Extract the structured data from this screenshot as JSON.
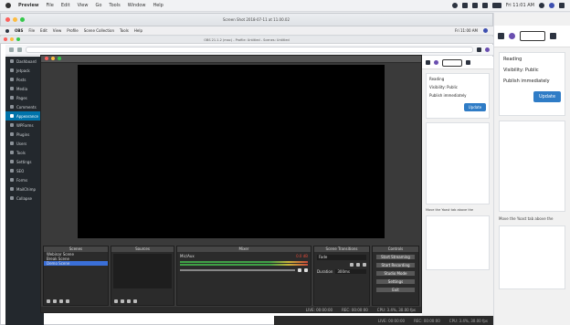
{
  "menubar": {
    "app_name": "Preview",
    "items": [
      "File",
      "Edit",
      "View",
      "Go",
      "Tools",
      "Window",
      "Help"
    ],
    "clock": "Fri 11:01 AM"
  },
  "preview_window": {
    "title": "Screen Shot 2018-07-11 at 11.00.02"
  },
  "inner_menubar": {
    "app_name": "OBS",
    "items": [
      "File",
      "Edit",
      "View",
      "Profile",
      "Scene Collection",
      "Tools",
      "Help"
    ],
    "clock": "Fri 11:00 AM"
  },
  "inner_title": {
    "text": "OBS 21.1.2 (mac) - Profile: Untitled - Scenes: Untitled"
  },
  "wp_sidebar": {
    "items": [
      "Dashboard",
      "Jetpack",
      "Posts",
      "Media",
      "Pages",
      "Comments",
      "Appearance",
      "WPForms",
      "Plugins",
      "Users",
      "Tools",
      "Settings",
      "SEO",
      "Forms",
      "MailChimp",
      "Collapse"
    ]
  },
  "right_panel": {
    "lines": [
      "Reading",
      "Visibility: Public",
      "Publish immediately",
      "Update"
    ],
    "update_label": "Update",
    "note": "Move the Yoast tab above the"
  },
  "obs": {
    "docks": {
      "scenes": "Scenes",
      "sources": "Sources",
      "mixer": "Mixer",
      "transitions": "Scene Transitions",
      "controls": "Controls"
    },
    "scenes": [
      "Webinar Scene",
      "Break Scene",
      "Demo Scene"
    ],
    "selected_scene_index": 2,
    "mixer_track": "Mic/Aux",
    "mixer_level_db": "0.0 dB",
    "transition_type": "Fade",
    "duration_label": "Duration",
    "duration_value": "300ms",
    "controls": [
      "Start Streaming",
      "Start Recording",
      "Studio Mode",
      "Settings",
      "Exit"
    ],
    "status": [
      "LIVE: 00:00:00",
      "REC: 00:00:00",
      "CPU: 3.4%, 30.00 fps"
    ]
  },
  "bottom_status": [
    "LIVE: 00:00:00",
    "REC: 00:00:00",
    "CPU: 3.4%, 30.00 fps"
  ],
  "colors": {
    "wp_sidebar": "#23282d",
    "wp_active": "#0073aa",
    "obs_bg": "#3a3a3a",
    "button_blue": "#2f7cc6"
  }
}
